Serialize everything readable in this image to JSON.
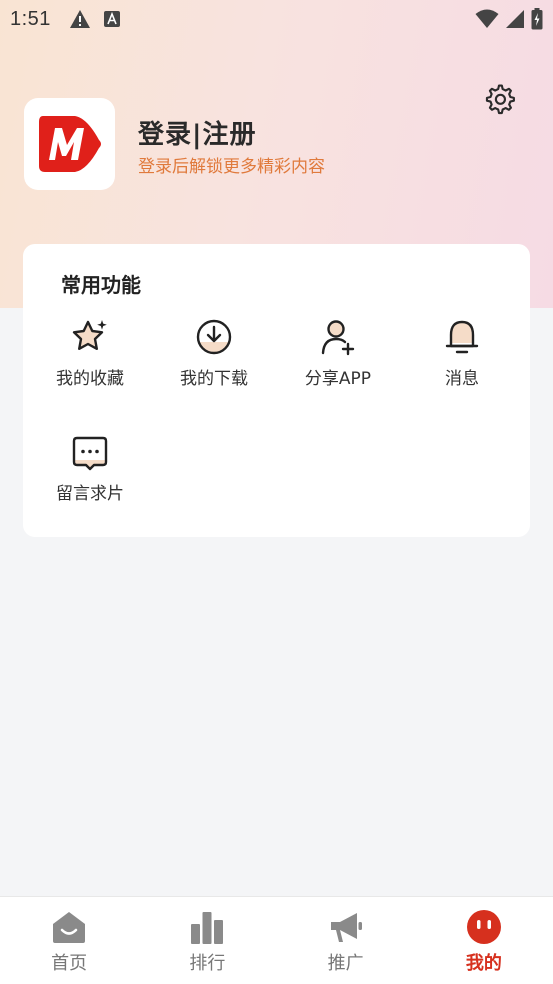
{
  "status_bar": {
    "time": "1:51"
  },
  "header": {
    "login_title": "登录|注册",
    "login_subtitle": "登录后解锁更多精彩内容"
  },
  "common_functions": {
    "title": "常用功能",
    "items": [
      {
        "label": "我的收藏",
        "icon": "star-icon"
      },
      {
        "label": "我的下载",
        "icon": "download-icon"
      },
      {
        "label": "分享APP",
        "icon": "add-user-icon"
      },
      {
        "label": "消息",
        "icon": "bell-icon"
      },
      {
        "label": "留言求片",
        "icon": "chat-bubble-icon"
      }
    ]
  },
  "bottom_nav": {
    "items": [
      {
        "label": "首页",
        "icon": "home-icon"
      },
      {
        "label": "排行",
        "icon": "bar-chart-icon"
      },
      {
        "label": "推广",
        "icon": "megaphone-icon"
      },
      {
        "label": "我的",
        "icon": "profile-face-icon",
        "active": true
      }
    ]
  },
  "colors": {
    "accent": "#d6301e",
    "subtitle": "#e07a3c",
    "logo_red": "#e0201a"
  }
}
